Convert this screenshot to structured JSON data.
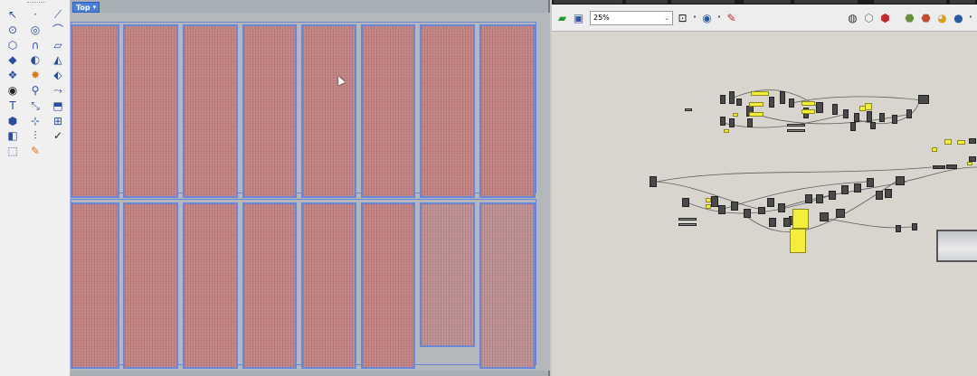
{
  "viewport": {
    "tab_label": "Top",
    "tab_arrow": "▾"
  },
  "toolbar": {
    "tools": [
      {
        "icon": "↖",
        "name": "select-icon",
        "cls": ""
      },
      {
        "icon": "·",
        "name": "point-icon",
        "cls": ""
      },
      {
        "icon": "⟋",
        "name": "polyline-icon",
        "cls": ""
      },
      {
        "icon": "⊙",
        "name": "circle-icon",
        "cls": ""
      },
      {
        "icon": "◎",
        "name": "ellipse-icon",
        "cls": ""
      },
      {
        "icon": "⌒",
        "name": "arc-icon",
        "cls": ""
      },
      {
        "icon": "⬡",
        "name": "polygon-icon",
        "cls": ""
      },
      {
        "icon": "∩",
        "name": "curve-icon",
        "cls": ""
      },
      {
        "icon": "▱",
        "name": "rectangle-icon",
        "cls": ""
      },
      {
        "icon": "◆",
        "name": "box-icon",
        "cls": ""
      },
      {
        "icon": "◐",
        "name": "sphere-icon",
        "cls": ""
      },
      {
        "icon": "◭",
        "name": "surface-icon",
        "cls": ""
      },
      {
        "icon": "❖",
        "name": "mesh-icon",
        "cls": ""
      },
      {
        "icon": "✸",
        "name": "explode-icon",
        "cls": "orange"
      },
      {
        "icon": "⬖",
        "name": "boolean-icon",
        "cls": ""
      },
      {
        "icon": "◉",
        "name": "solid-icon",
        "cls": "dark"
      },
      {
        "icon": "⚲",
        "name": "analyze-icon",
        "cls": ""
      },
      {
        "icon": "⤳",
        "name": "fillet-icon",
        "cls": ""
      },
      {
        "icon": "T",
        "name": "text-icon",
        "cls": ""
      },
      {
        "icon": "⤡",
        "name": "scale-icon",
        "cls": ""
      },
      {
        "icon": "⬒",
        "name": "extrude-icon",
        "cls": ""
      },
      {
        "icon": "⬢",
        "name": "cap-icon",
        "cls": ""
      },
      {
        "icon": "⊹",
        "name": "transform-icon",
        "cls": ""
      },
      {
        "icon": "⊞",
        "name": "array-icon",
        "cls": ""
      },
      {
        "icon": "◧",
        "name": "render-icon",
        "cls": ""
      },
      {
        "icon": "⫶",
        "name": "dimension-icon",
        "cls": "dark"
      },
      {
        "icon": "✓",
        "name": "check-icon",
        "cls": "dark"
      },
      {
        "icon": "⬚",
        "name": "layer-icon",
        "cls": ""
      },
      {
        "icon": "✎",
        "name": "paint-icon",
        "cls": "orange"
      }
    ]
  },
  "grasshopper": {
    "zoom_value": "25%",
    "zoom_arrow": "⌄"
  },
  "colors": {
    "panel_fill": "#c28585",
    "panel_border": "#6a86d6",
    "gh_canvas": "#d8d5ce",
    "gh_panel_yellow": "#f3ee3c"
  }
}
